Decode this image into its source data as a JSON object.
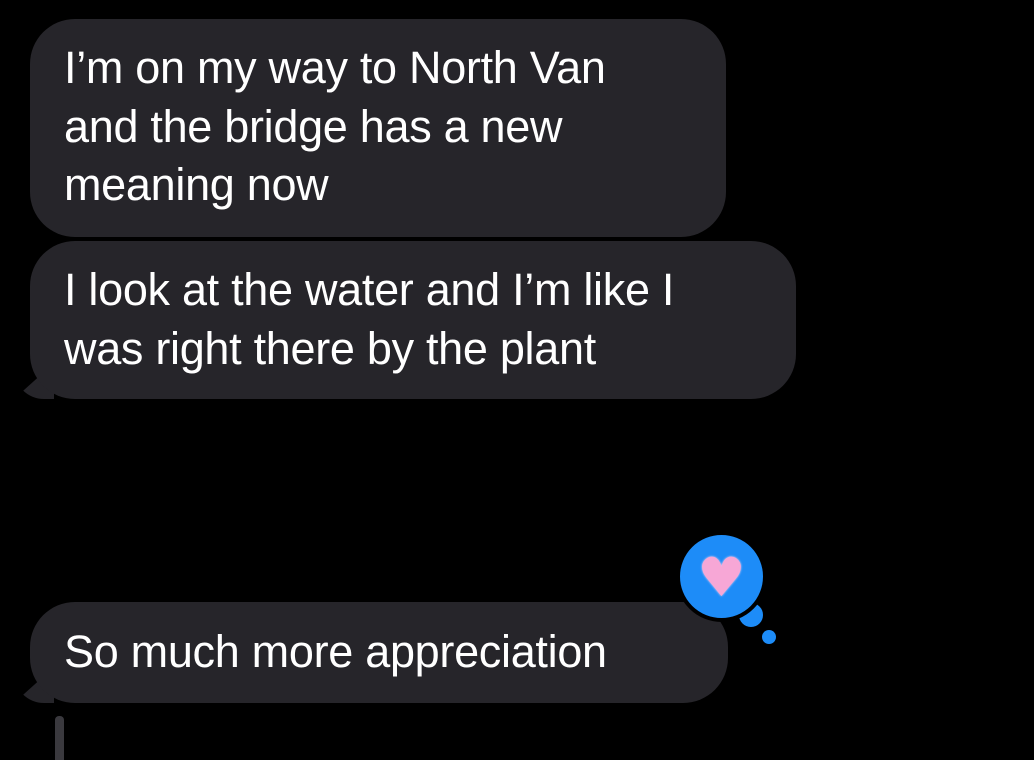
{
  "conversation": {
    "messages": [
      {
        "sender": "other",
        "text": "I’m on my way to North Van and the bridge has a new meaning now"
      },
      {
        "sender": "other",
        "text": "I look at the water and I’m like I was right there by the plant"
      },
      {
        "sender": "other",
        "text": "So much more appreciation",
        "reaction": "heart"
      }
    ]
  },
  "tapback": {
    "icon": "heart-icon",
    "glyph": "♥",
    "color": "#1d8cf8",
    "heart_color": "#f7a7d6"
  },
  "colors": {
    "background": "#000000",
    "bubble": "#26252a",
    "text": "#ffffff"
  }
}
